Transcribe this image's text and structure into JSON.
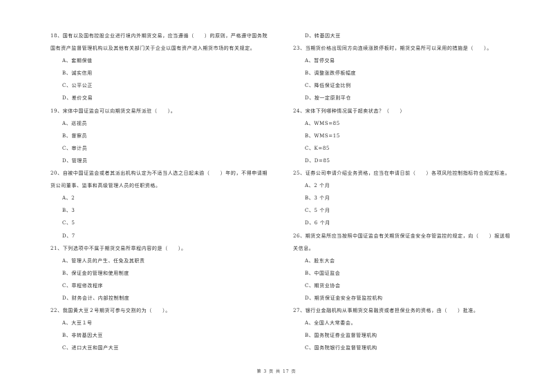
{
  "left_column": {
    "questions": [
      {
        "lines": [
          "18、国有以及国有控股企业进行境内外期货交易，应当遵循（　　）的原则，严格遵守国务院",
          "国有资产监督管理机构以及其他有关部门关于企业以国有资产进入期货市场的有关规定。"
        ],
        "options": [
          "A、套期保值",
          "B、诚实信用",
          "C、公平公正",
          "D、差价交易"
        ]
      },
      {
        "lines": [
          "19、宋体中国证监会可以向期货交易所派驻（　　）。"
        ],
        "options": [
          "A、巡视员",
          "B、督察员",
          "C、审计员",
          "D、管理员"
        ]
      },
      {
        "lines": [
          "20、自被中国证监会或者其派出机构认定为不适当人选之日起未逾（　　）年的，不得申请期",
          "货公司董事、监事和高级管理人员的任职资格。"
        ],
        "options": [
          "A、2",
          "B、3",
          "C、5",
          "D、7"
        ]
      },
      {
        "lines": [
          "21、下列选项中不属于期货交易所章程内容的是（　　）。"
        ],
        "options": [
          "A、管理人员的产生、任免及其职责",
          "B、保证金的管理和使用制度",
          "C、章程修改程序",
          "D、财务会计、内部控制制度"
        ]
      },
      {
        "lines": [
          "22、我国黄大豆２号期货可参与交割的为（　　）。"
        ],
        "options": [
          "A、大豆１号",
          "B、非转基因大豆",
          "C、进口大豆和国产大豆"
        ]
      }
    ]
  },
  "right_column": {
    "continued_option": "D、转基因大豆",
    "questions": [
      {
        "lines": [
          "23、当期货价格出现同方向连续涨跌停板时，期货交易所可以采用的措施是（　　）。"
        ],
        "options": [
          "A、暂停交易",
          "B、调整涨跌停板幅度",
          "C、降低保证金比例",
          "D、按一定原则平仓"
        ]
      },
      {
        "lines": [
          "24、宋体下列哪种情况属于超卖状态？（　　）"
        ],
        "options": [
          "A、WMS=85",
          "B、WMS=15",
          "C、K=85",
          "D、D=85"
        ]
      },
      {
        "lines": [
          "25、证券公司申请介绍业务资格，应当在申请日前（　　）各项风险控制指标符合规定标准。"
        ],
        "options": [
          "A、2 个月",
          "B、3 个月",
          "C、5 个月",
          "D、6 个月"
        ]
      },
      {
        "lines": [
          "26、期货交易所应当按照中国证监会有关期货保证金安全存管监控的规定，向（　　）报送相",
          "关信息。"
        ],
        "options": [
          "A、股东大会",
          "B、中国证监会",
          "C、期货业协会",
          "D、期货保证金安全存管监控机构"
        ]
      },
      {
        "lines": [
          "27、银行业金融机构从事期货交易融资或者担保业务的资格，由（　　）批准。"
        ],
        "options": [
          "A、全国人大常委会。",
          "B、国务院证券业监督管理机构",
          "C、国务院银行业监督管理机构"
        ]
      }
    ]
  },
  "footer": {
    "page_label": "第 3 页 共 17 页"
  }
}
